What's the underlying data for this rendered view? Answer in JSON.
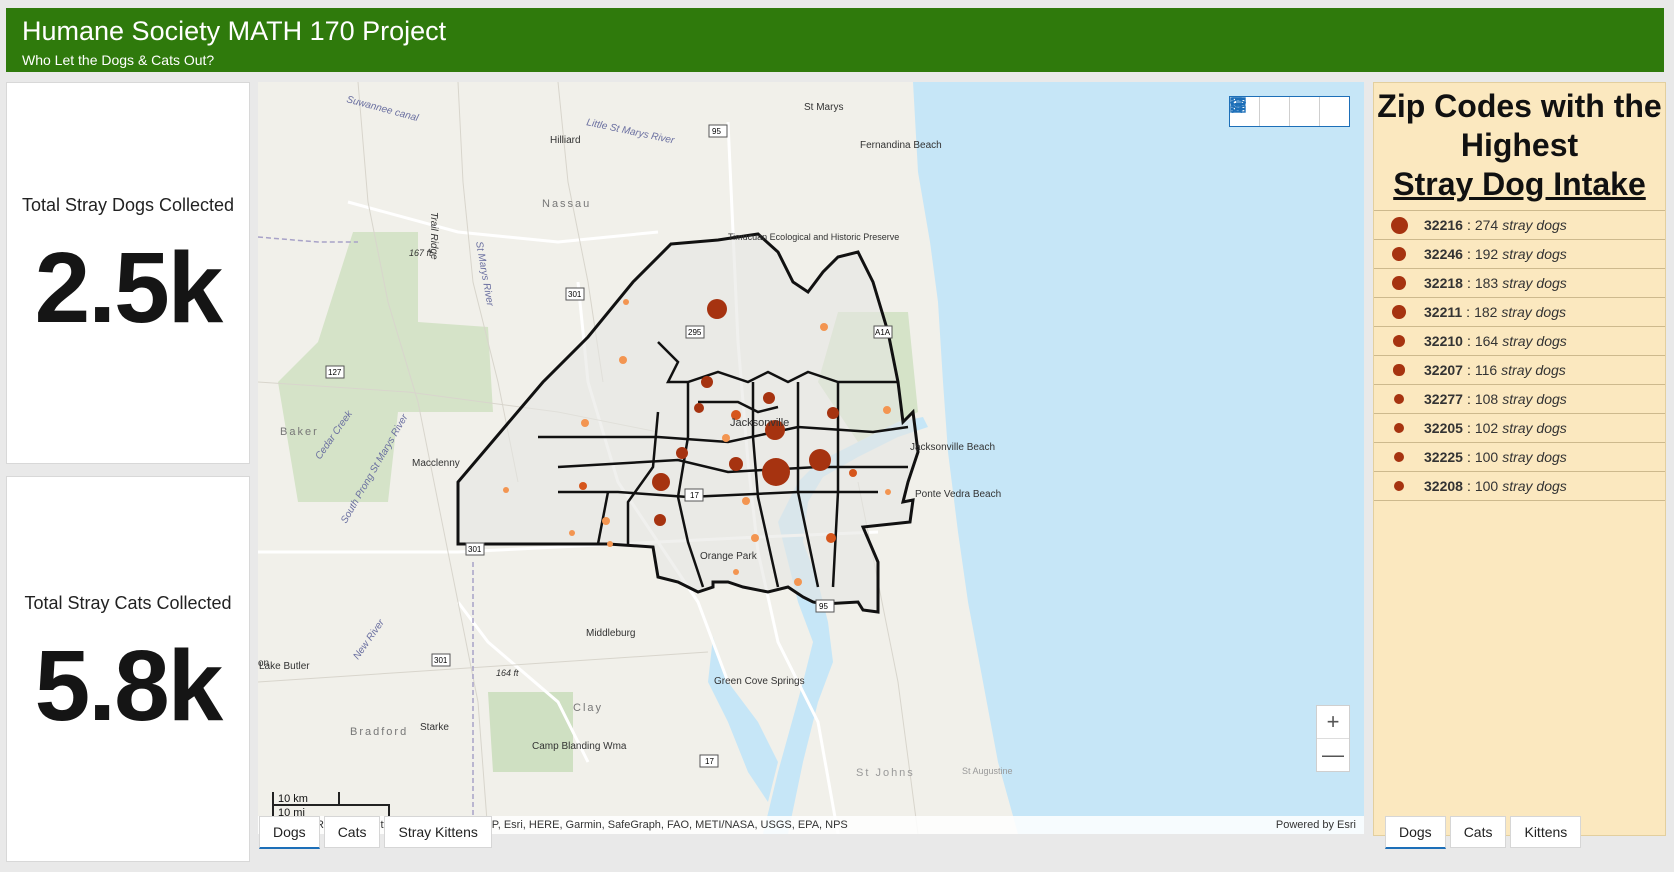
{
  "header": {
    "title": "Humane Society MATH 170 Project",
    "subtitle": "Who Let the Dogs & Cats Out?",
    "bg_color": "#2f7a0c"
  },
  "indicators": {
    "dogs": {
      "label": "Total Stray Dogs Collected",
      "value": "2.5k"
    },
    "cats": {
      "label": "Total Stray Cats Collected",
      "value": "5.8k"
    }
  },
  "map": {
    "toolbar": [
      {
        "icon": "bookmark-icon"
      },
      {
        "icon": "legend-list-icon"
      },
      {
        "icon": "layers-icon"
      },
      {
        "icon": "basemap-gallery-icon"
      }
    ],
    "zoom_in": "+",
    "zoom_out": "—",
    "scale_km": "10 km",
    "scale_mi": "10 mi",
    "attribution": "Esri, CGIAR, USGS | City of Jacksonville, FDEP, Esri, HERE, Garmin, SafeGraph, FAO, METI/NASA, USGS, EPA, NPS",
    "powered_by": "Powered by Esri",
    "labels": [
      "Suwannee canal",
      "Hilliard",
      "Little St Marys River",
      "St Marys",
      "Fernandina Beach",
      "Nassau",
      "Trail Ridge",
      "167 ft",
      "St Marys River",
      "Timucuan Ecological and Historic Preserve",
      "Baker",
      "Cedar Creek",
      "Macclenny",
      "South Prong St Marys River",
      "Jacksonville",
      "Jacksonville Beach",
      "Ponte Vedra Beach",
      "Orange Park",
      "Middleburg",
      "Lake Butler",
      "New River",
      "164 ft",
      "Green Cove Springs",
      "Clay",
      "Bradford",
      "Starke",
      "Camp Blanding Wma",
      "St Johns",
      "St Augustine",
      "on"
    ],
    "shields": [
      "95",
      "301",
      "295",
      "A1A",
      "127",
      "17",
      "301",
      "95",
      "17",
      "301"
    ],
    "colors": {
      "water": "#c6e6f7",
      "land": "#f1f0ea",
      "green": "#c9deb8",
      "dot_dark": "#a63310",
      "dot_mid": "#d6561c",
      "dot_light": "#f39551"
    }
  },
  "tabs_left": [
    {
      "label": "Dogs",
      "active": true
    },
    {
      "label": "Cats",
      "active": false
    },
    {
      "label": "Stray Kittens",
      "active": false
    }
  ],
  "tabs_right": [
    {
      "label": "Dogs",
      "active": true
    },
    {
      "label": "Cats",
      "active": false
    },
    {
      "label": "Kittens",
      "active": false
    }
  ],
  "zip_panel": {
    "title_line1": "Zip Codes with the",
    "title_line2": "Highest",
    "title_line3": "Stray Dog Intake",
    "unit": "stray dogs",
    "items": [
      {
        "zip": "32216",
        "count": 274
      },
      {
        "zip": "32246",
        "count": 192
      },
      {
        "zip": "32218",
        "count": 183
      },
      {
        "zip": "32211",
        "count": 182
      },
      {
        "zip": "32210",
        "count": 164
      },
      {
        "zip": "32207",
        "count": 116
      },
      {
        "zip": "32277",
        "count": 108
      },
      {
        "zip": "32205",
        "count": 102
      },
      {
        "zip": "32225",
        "count": 100
      },
      {
        "zip": "32208",
        "count": 100
      }
    ]
  }
}
